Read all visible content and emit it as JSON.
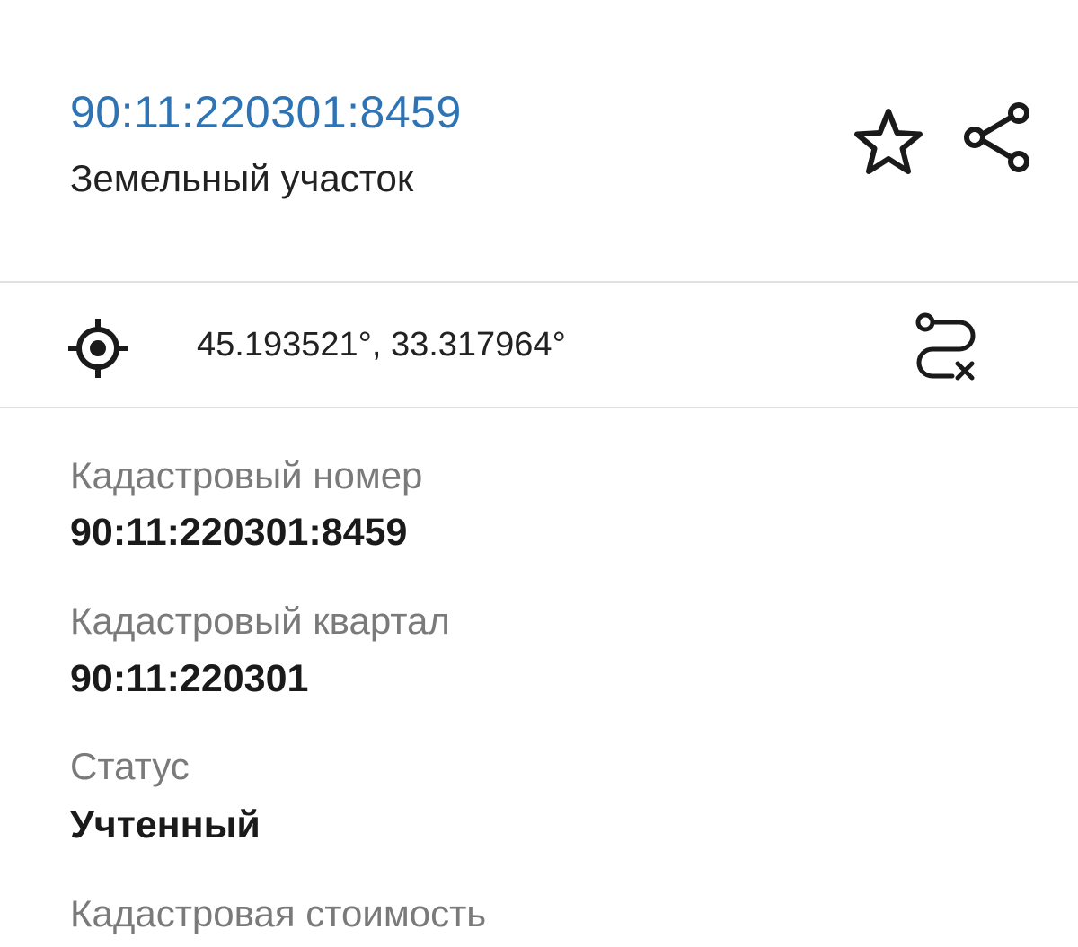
{
  "header": {
    "cadastral_id": "90:11:220301:8459",
    "object_type": "Земельный участок"
  },
  "icons": {
    "favorite": "star-outline-icon",
    "share": "share-icon",
    "locate": "target-icon",
    "route": "route-remove-icon"
  },
  "location": {
    "coordinates": "45.193521°, 33.317964°"
  },
  "details": {
    "items": [
      {
        "label": "Кадастровый номер",
        "value": "90:11:220301:8459"
      },
      {
        "label": "Кадастровый квартал",
        "value": "90:11:220301"
      },
      {
        "label": "Статус",
        "value": "Учтенный"
      },
      {
        "label": "Кадастровая стоимость",
        "value": ""
      }
    ]
  },
  "colors": {
    "accent": "#2e74b5",
    "divider": "#e0e0e0",
    "label": "#7a7a7a",
    "text": "#1a1a1a"
  }
}
